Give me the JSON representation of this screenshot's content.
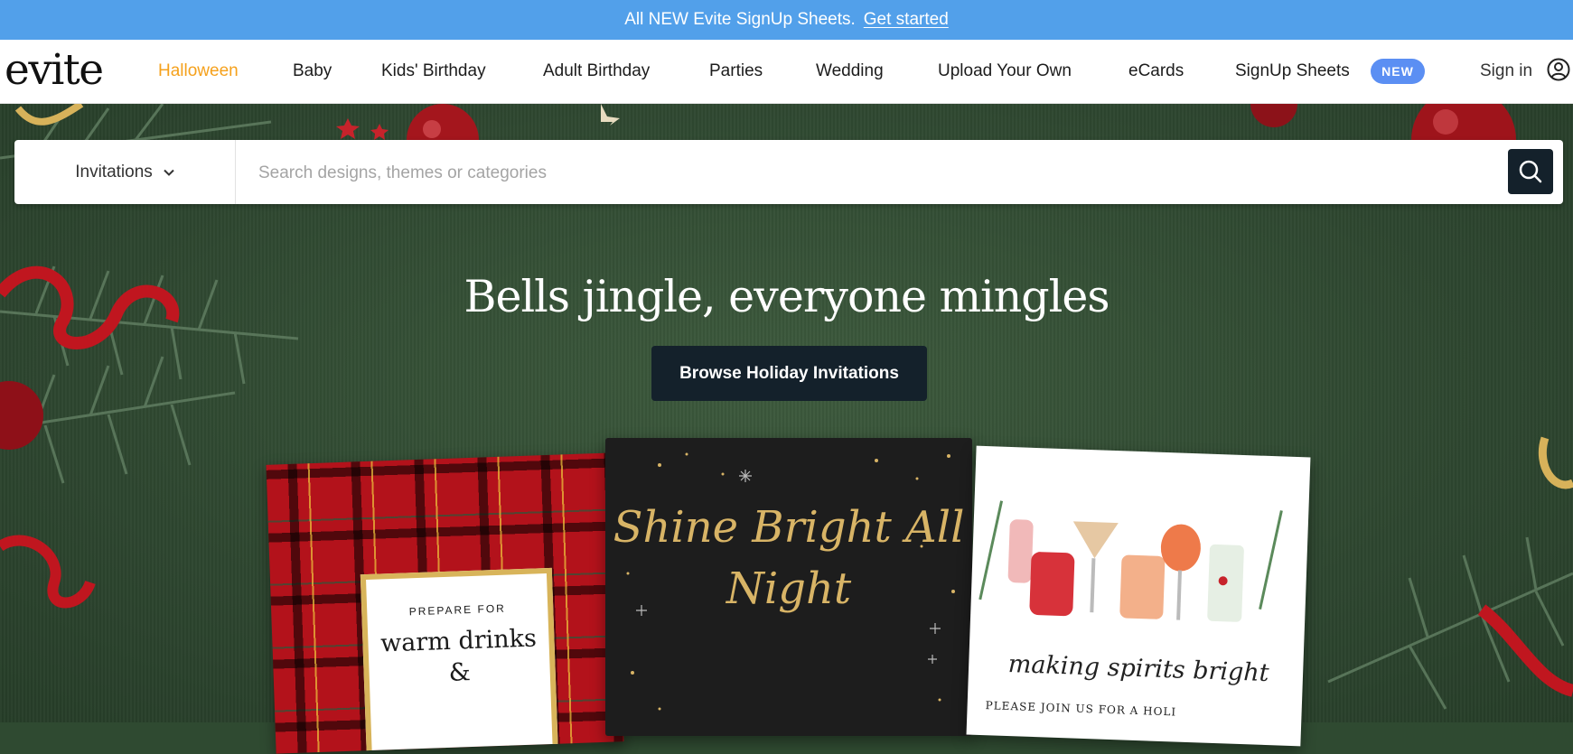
{
  "promo": {
    "text": "All NEW Evite SignUp Sheets.",
    "link": "Get started",
    "bg_color": "#52a0ea"
  },
  "header": {
    "logo": "evite",
    "nav": [
      {
        "label": "Halloween",
        "active": true
      },
      {
        "label": "Baby"
      },
      {
        "label": "Kids' Birthday"
      },
      {
        "label": "Adult Birthday"
      },
      {
        "label": "Parties"
      },
      {
        "label": "Wedding"
      },
      {
        "label": "Upload Your Own"
      },
      {
        "label": "eCards"
      },
      {
        "label": "SignUp Sheets"
      }
    ],
    "new_badge": "NEW",
    "sign_in": "Sign in",
    "active_color": "#f5a11c",
    "badge_color": "#5b8ff3",
    "icons": {
      "account": "user-circle-icon"
    }
  },
  "search": {
    "category": "Invitations",
    "placeholder": "Search designs, themes or categories",
    "value": "",
    "icons": {
      "dropdown": "chevron-down-icon",
      "submit": "search-icon"
    }
  },
  "hero": {
    "headline": "Bells jingle, everyone mingles",
    "cta": "Browse Holiday Invitations",
    "cta_color": "#14212b",
    "cards": [
      {
        "top": "PREPARE FOR",
        "main": "warm drinks &"
      },
      {
        "main": "Shine Bright All Night"
      },
      {
        "main": "making spirits bright",
        "sub": "PLEASE JOIN US FOR A HOLI"
      }
    ]
  }
}
